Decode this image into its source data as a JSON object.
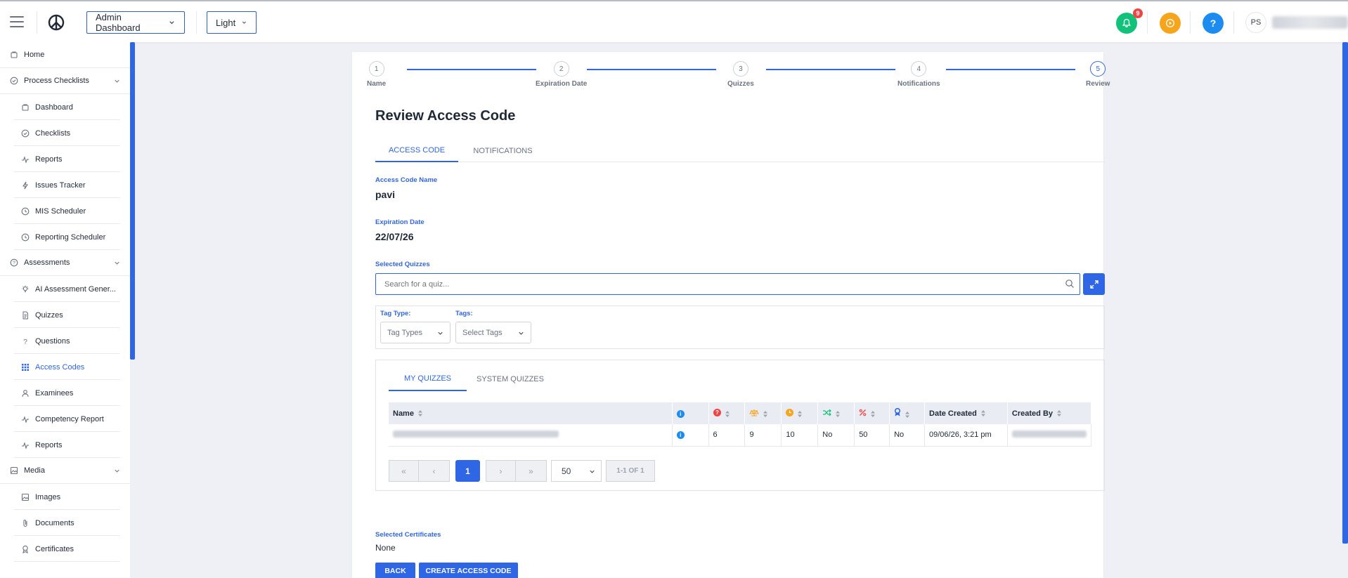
{
  "topbar": {
    "dashboard_select": "Admin Dashboard",
    "theme_select": "Light",
    "notification_count": "9",
    "help_label": "?",
    "avatar_initials": "PS",
    "colors": {
      "bell": "#12c27b",
      "play": "#f7a51c",
      "help": "#1d8cf0"
    }
  },
  "sidebar": {
    "items": [
      {
        "label": "Home",
        "icon": "home-icon",
        "level": "top"
      },
      {
        "label": "Process Checklists",
        "icon": "check-circle-icon",
        "level": "top",
        "expandable": true
      },
      {
        "label": "Dashboard",
        "icon": "dashboard-icon",
        "level": "sub"
      },
      {
        "label": "Checklists",
        "icon": "check-circle-icon",
        "level": "sub"
      },
      {
        "label": "Reports",
        "icon": "pulse-icon",
        "level": "sub"
      },
      {
        "label": "Issues Tracker",
        "icon": "bolt-icon",
        "level": "sub"
      },
      {
        "label": "MIS Scheduler",
        "icon": "clock-icon",
        "level": "sub"
      },
      {
        "label": "Reporting Scheduler",
        "icon": "clock-icon",
        "level": "sub"
      },
      {
        "label": "Assessments",
        "icon": "question-circle-icon",
        "level": "top",
        "expandable": true
      },
      {
        "label": "AI Assessment Gener...",
        "icon": "bulb-icon",
        "level": "sub"
      },
      {
        "label": "Quizzes",
        "icon": "document-icon",
        "level": "sub"
      },
      {
        "label": "Questions",
        "icon": "question-mark-icon",
        "level": "sub"
      },
      {
        "label": "Access Codes",
        "icon": "grid-icon",
        "level": "sub",
        "active": true
      },
      {
        "label": "Examinees",
        "icon": "user-icon",
        "level": "sub"
      },
      {
        "label": "Competency Report",
        "icon": "pulse-icon",
        "level": "sub"
      },
      {
        "label": "Reports",
        "icon": "pulse-icon",
        "level": "sub"
      },
      {
        "label": "Media",
        "icon": "image-icon",
        "level": "top",
        "expandable": true
      },
      {
        "label": "Images",
        "icon": "image-icon",
        "level": "sub"
      },
      {
        "label": "Documents",
        "icon": "paperclip-icon",
        "level": "sub"
      },
      {
        "label": "Certificates",
        "icon": "award-icon",
        "level": "sub"
      }
    ]
  },
  "stepper": {
    "steps": [
      {
        "num": "1",
        "label": "Name"
      },
      {
        "num": "2",
        "label": "Expiration Date"
      },
      {
        "num": "3",
        "label": "Quizzes"
      },
      {
        "num": "4",
        "label": "Notifications"
      },
      {
        "num": "5",
        "label": "Review",
        "current": true
      }
    ]
  },
  "page": {
    "title": "Review Access Code",
    "tabs": [
      "ACCESS CODE",
      "NOTIFICATIONS"
    ],
    "access_code_name_label": "Access Code Name",
    "access_code_name": "pavi",
    "expiration_label": "Expiration Date",
    "expiration_date": "22/07/26",
    "selected_quizzes_label": "Selected Quizzes",
    "search_placeholder": "Search for a quiz...",
    "tag_type_label": "Tag Type:",
    "tag_type_value": "Tag Types",
    "tags_label": "Tags:",
    "tags_value": "Select Tags",
    "quiz_tabs": [
      "MY QUIZZES",
      "SYSTEM QUIZZES"
    ],
    "selected_certificates_label": "Selected Certificates",
    "selected_certificates": "None",
    "back_button": "BACK",
    "create_button": "CREATE ACCESS CODE"
  },
  "table": {
    "headers": {
      "name": "Name",
      "date_created": "Date Created",
      "created_by": "Created By"
    },
    "icon_columns": [
      "info-icon",
      "question-icon",
      "scale-icon",
      "timer-icon",
      "shuffle-icon",
      "percent-icon",
      "award-icon"
    ],
    "rows": [
      {
        "questions": "6",
        "weight": "9",
        "time": "10",
        "shuffle": "No",
        "pass_percent": "50",
        "certificate": "No",
        "date_created": "09/06/26, 3:21 pm"
      }
    ]
  },
  "pagination": {
    "first": "«",
    "prev": "‹",
    "current_page": "1",
    "next": "›",
    "last": "»",
    "page_size": "50",
    "range": "1-1 OF 1"
  }
}
